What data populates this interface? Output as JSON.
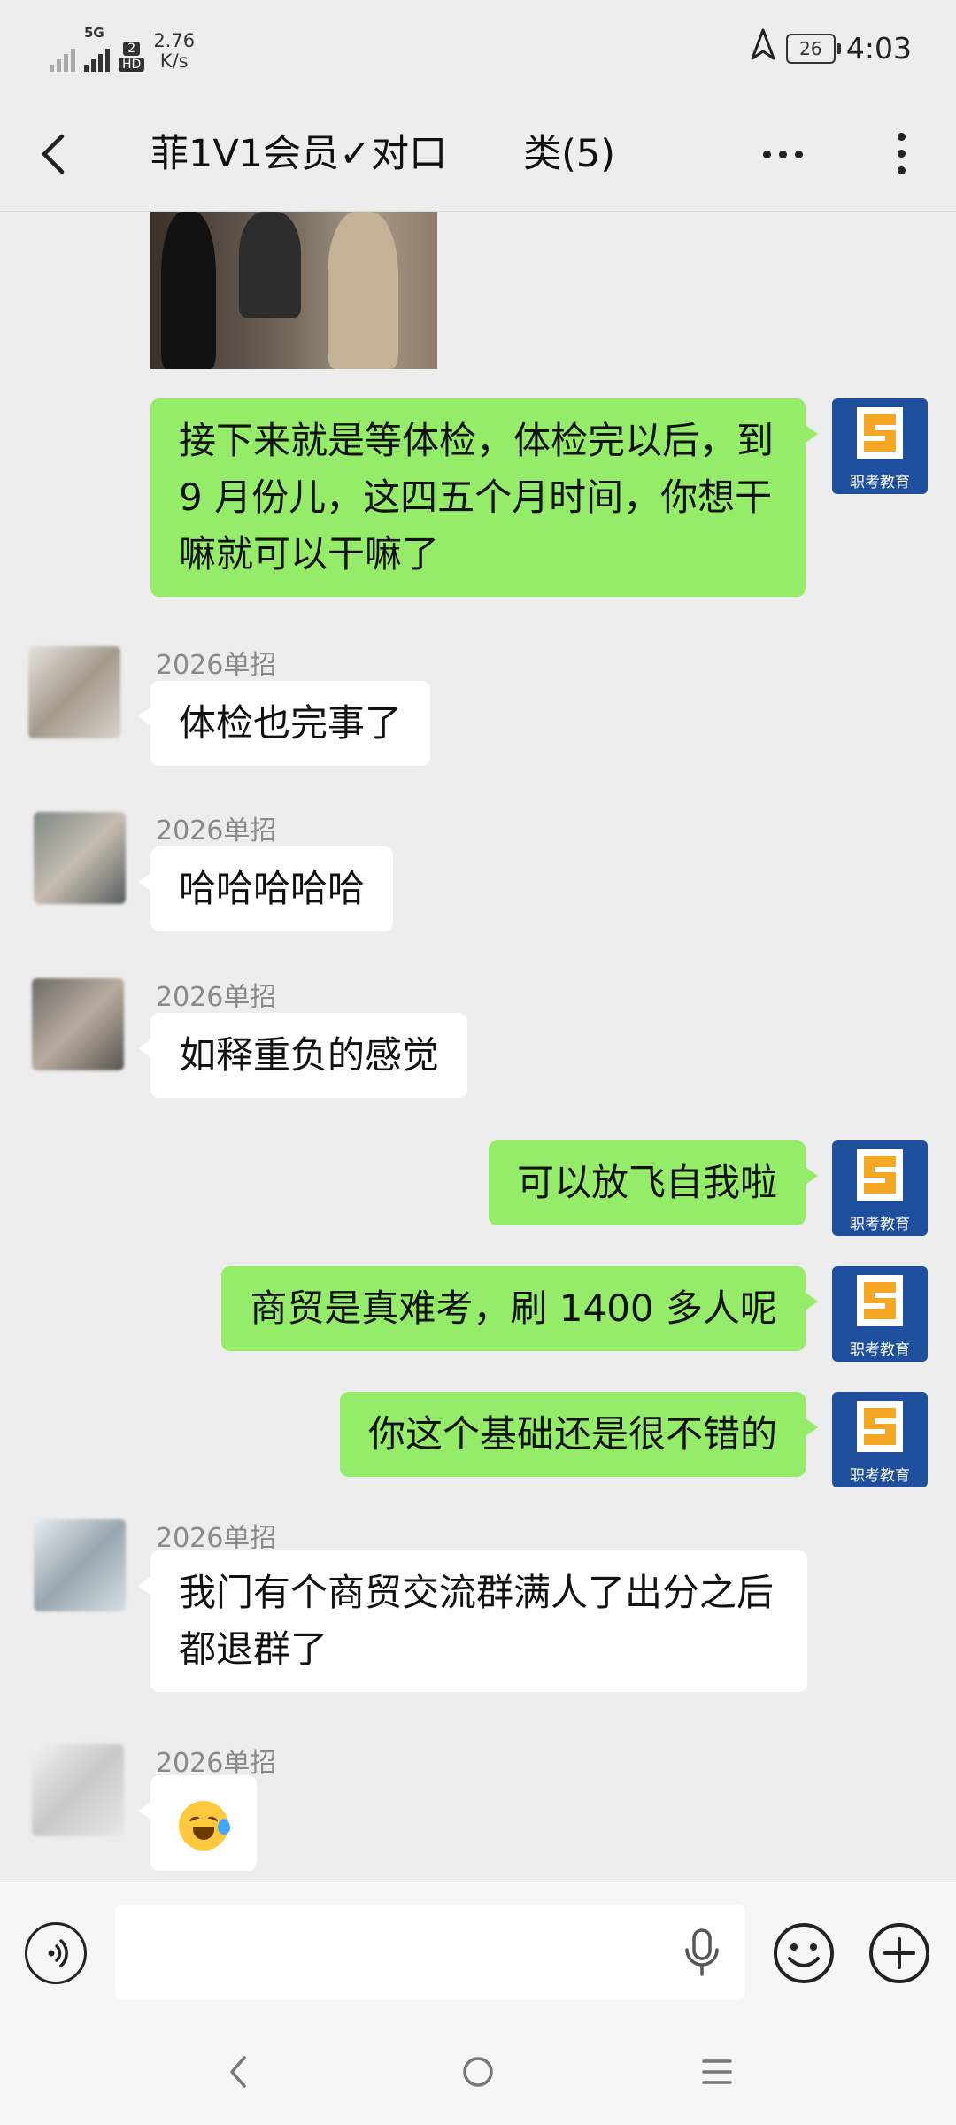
{
  "status_bar": {
    "network_tag": "5G",
    "sim_badge": "2",
    "hd_badge": "HD",
    "net_speed": "2.76",
    "net_speed_unit": "K/s",
    "battery": "26",
    "time": "4:03"
  },
  "header": {
    "title": "菲1V1会员✓对口　　类(5)"
  },
  "brand_avatar_text": "职考教育",
  "messages": [
    {
      "type": "out",
      "text": "接下来就是等体检，体检完以后，到 9 月份儿，这四五个月时间，你想干嘛就可以干嘛了"
    },
    {
      "type": "in",
      "sender": "2026单招",
      "text": "体检也完事了"
    },
    {
      "type": "in",
      "sender": "2026单招",
      "text": "哈哈哈哈哈"
    },
    {
      "type": "in",
      "sender": "2026单招",
      "text": "如释重负的感觉"
    },
    {
      "type": "out",
      "text": "可以放飞自我啦"
    },
    {
      "type": "out",
      "text": "商贸是真难考，刷 1400 多人呢"
    },
    {
      "type": "out",
      "text": "你这个基础还是很不错的"
    },
    {
      "type": "in",
      "sender": "2026单招",
      "text": "我门有个商贸交流群满人了出分之后都退群了"
    },
    {
      "type": "in",
      "sender": "2026单招",
      "emoji": "laughing-with-tears"
    }
  ],
  "input": {
    "value": "",
    "placeholder": ""
  },
  "colors": {
    "background": "#ededed",
    "outgoing_bubble": "#95ec69",
    "incoming_bubble": "#ffffff",
    "brand_avatar": "#1e4f9c"
  }
}
